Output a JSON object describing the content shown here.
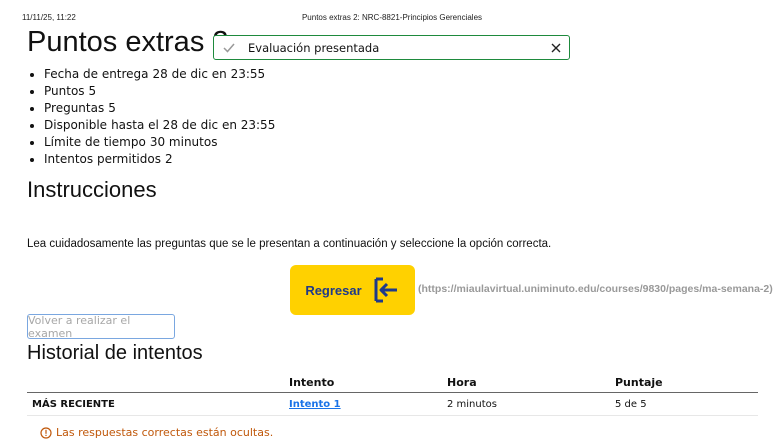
{
  "print_header": {
    "datetime": "11/11/25, 11:22",
    "document_title": "Puntos extras 2: NRC-8821-Principios Gerenciales"
  },
  "quiz": {
    "title": "Puntos extras 2",
    "details": [
      {
        "label": "Fecha de entrega",
        "value": "28 de dic en 23:55"
      },
      {
        "label": "Puntos",
        "value": "5"
      },
      {
        "label": "Preguntas",
        "value": "5"
      },
      {
        "label": "Disponible",
        "value": "hasta el 28 de dic en 23:55"
      },
      {
        "label": "Límite de tiempo",
        "value": "30 minutos"
      },
      {
        "label": "Intentos permitidos",
        "value": "2"
      }
    ]
  },
  "instructions": {
    "heading": "Instrucciones",
    "text": "Lea cuidadosamente las preguntas que se le presentan a continuación y seleccione la opción correcta.",
    "back_button_label": "Regresar",
    "back_url_text": "(https://miaulavirtual.uniminuto.edu/courses/9830/pages/ma-semana-2)"
  },
  "retake_button_label": "Volver a realizar el examen",
  "history": {
    "heading": "Historial de intentos",
    "columns": [
      "",
      "Intento",
      "Hora",
      "Puntaje"
    ],
    "rows": [
      {
        "label": "MÁS RECIENTE",
        "attempt": "Intento 1",
        "time": "2 minutos",
        "score": "5 de 5"
      }
    ]
  },
  "hidden_answers_notice": "Las respuestas correctas están ocultas.",
  "toast": {
    "message": "Evaluación presentada"
  },
  "colors": {
    "accent_yellow": "#ffd100",
    "link_blue": "#1a73e8",
    "success_green": "#1e8a3d",
    "warning_orange": "#c0580b"
  },
  "icons": [
    "sign-out-arrow-icon",
    "check-icon",
    "close-icon",
    "warning-circle-icon"
  ]
}
